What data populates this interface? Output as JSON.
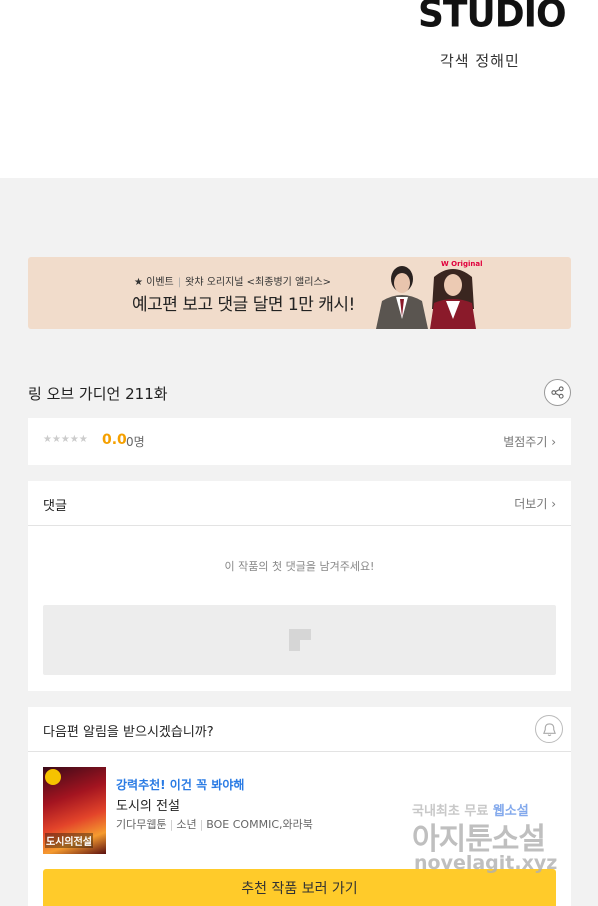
{
  "header": {
    "studio_logo": "STUDIO",
    "credit": "각색 정해민"
  },
  "banner": {
    "event_label": "★ 이벤트",
    "event_detail": "왓챠 오리지널 <최종병기 앨리스>",
    "headline": "예고편 보고 댓글 달면 1만 캐시!",
    "brand_mark": "W Original",
    "bg_color": "#f1dccb"
  },
  "episode": {
    "title": "링 오브 가디언 211화",
    "share_icon": "share-icon"
  },
  "rating": {
    "stars": "★★★★★",
    "score": "0.0",
    "count": "0명",
    "rate_label": "별점주기 ›"
  },
  "comments": {
    "title": "댓글",
    "more_label": "더보기 ›",
    "empty_message": "이 작품의 첫 댓글을 남겨주세요!"
  },
  "notify": {
    "question": "다음편 알림을 받으시겠습니까?",
    "bell_icon": "bell-icon"
  },
  "recommendation": {
    "badge": "강력추천! 이건 꼭 봐야해",
    "title": "도시의 전설",
    "meta": [
      "기다무웹툰",
      "소년",
      "BOE COMMIC,와라북"
    ],
    "thumb_title": "도시의전설",
    "button_label": "추천 작품 보러 가기",
    "accent_color": "#ffcb2a"
  },
  "watermark": {
    "line1a": "국내최초 무료",
    "line1b": "웹소설",
    "line2": "아지툰소설",
    "line3": "novelagit.xyz"
  }
}
